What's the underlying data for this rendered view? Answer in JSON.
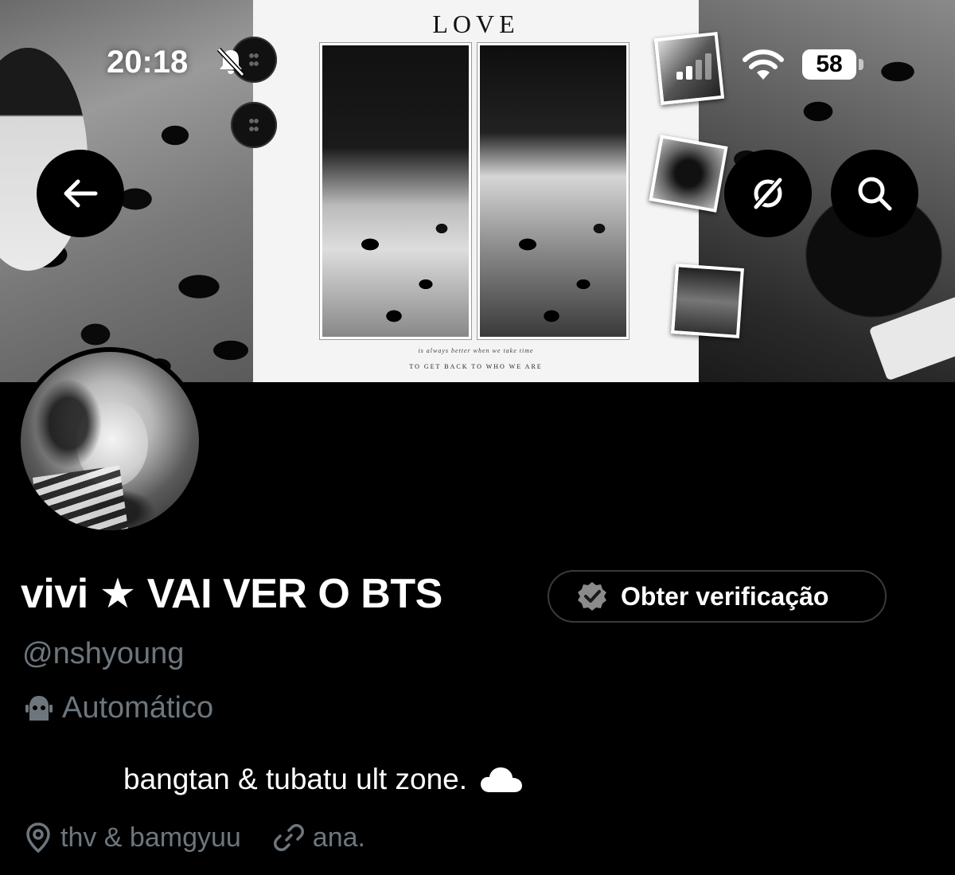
{
  "status_bar": {
    "time": "20:18",
    "battery": "58"
  },
  "banner": {
    "poster_title": "LOVE",
    "poster_caption_line1": "is always better when we take time",
    "poster_caption_line2": "TO GET BACK TO WHO WE ARE"
  },
  "header_buttons": {
    "back_icon": "arrow-left-icon",
    "grok_icon": "grok-icon",
    "search_icon": "search-icon"
  },
  "profile": {
    "display_name": "vivi ★ VAI VER O BTS",
    "verify_label": "Obter verificação",
    "handle": "@nshyoung",
    "automated_label": "Automático",
    "bio": "bangtan & tubatu ult zone.",
    "location": "thv & bamgyuu",
    "website": "ana."
  },
  "colors": {
    "background": "#000000",
    "text_primary": "#ffffff",
    "text_secondary": "#6e767d",
    "border": "#3a3a3a"
  }
}
